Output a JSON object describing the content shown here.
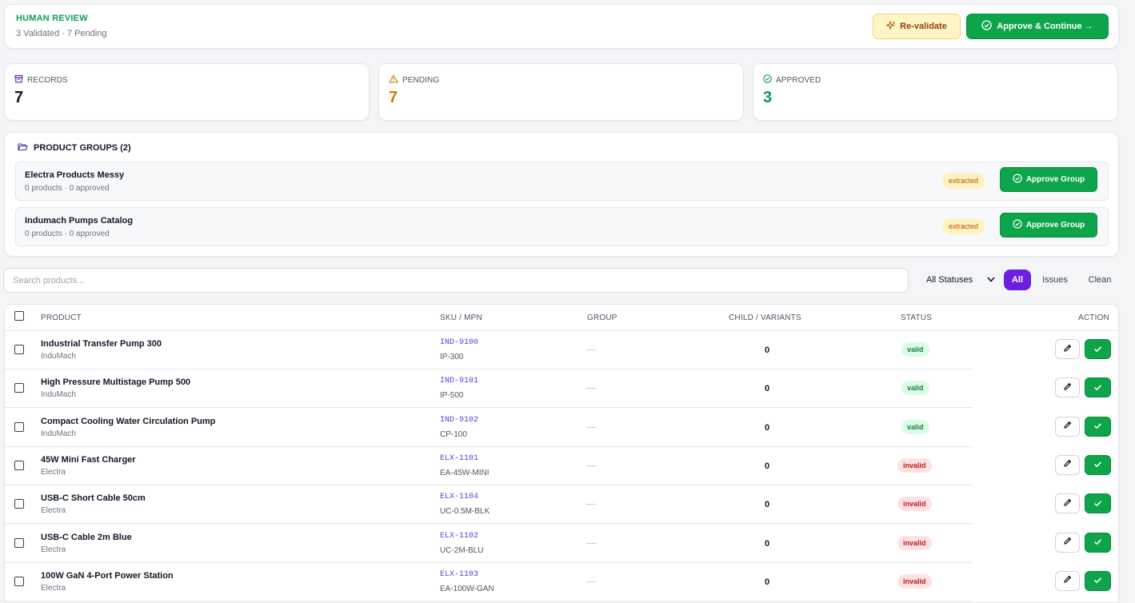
{
  "header": {
    "title": "HUMAN REVIEW",
    "subtitle": "3 Validated · 7 Pending",
    "revalidate_label": "Re-validate",
    "approve_continue_label": "Approve & Continue →"
  },
  "stats": {
    "records": {
      "label": "RECORDS",
      "value": "7",
      "color": "#111827"
    },
    "pending": {
      "label": "PENDING",
      "value": "7",
      "color": "#d97706"
    },
    "approved": {
      "label": "APPROVED",
      "value": "3",
      "color": "#059669"
    }
  },
  "groups": {
    "title": "PRODUCT GROUPS (2)",
    "items": [
      {
        "name": "Electra Products Messy",
        "sub": "0 products · 0 approved",
        "badge": "extracted",
        "button": "Approve Group"
      },
      {
        "name": "Indumach Pumps Catalog",
        "sub": "0 products · 0 approved",
        "badge": "extracted",
        "button": "Approve Group"
      }
    ]
  },
  "filters": {
    "search_placeholder": "Search products...",
    "status_select": "All Statuses",
    "all": "All",
    "issues": "Issues",
    "clean": "Clean"
  },
  "table": {
    "columns": {
      "product": "PRODUCT",
      "sku": "SKU / MPN",
      "group": "GROUP",
      "child": "CHILD / VARIANTS",
      "status": "STATUS",
      "action": "ACTION"
    },
    "rows": [
      {
        "name": "Industrial Transfer Pump 300",
        "brand": "InduMach",
        "sku": "IND-9100",
        "mpn": "IP-300",
        "child": "0",
        "status": "valid"
      },
      {
        "name": "High Pressure Multistage Pump 500",
        "brand": "InduMach",
        "sku": "IND-9101",
        "mpn": "IP-500",
        "child": "0",
        "status": "valid"
      },
      {
        "name": "Compact Cooling Water Circulation Pump",
        "brand": "InduMach",
        "sku": "IND-9102",
        "mpn": "CP-100",
        "child": "0",
        "status": "valid"
      },
      {
        "name": "45W Mini Fast Charger",
        "brand": "Electra",
        "sku": "ELX-1101",
        "mpn": "EA-45W-MINI",
        "child": "0",
        "status": "invalid"
      },
      {
        "name": "USB-C Short Cable 50cm",
        "brand": "Electra",
        "sku": "ELX-1104",
        "mpn": "UC-0.5M-BLK",
        "child": "0",
        "status": "invalid"
      },
      {
        "name": "USB-C Cable 2m Blue",
        "brand": "Electra",
        "sku": "ELX-1102",
        "mpn": "UC-2M-BLU",
        "child": "0",
        "status": "invalid"
      },
      {
        "name": "100W GaN 4-Port Power Station",
        "brand": "Electra",
        "sku": "ELX-1103",
        "mpn": "EA-100W-GAN",
        "child": "0",
        "status": "invalid"
      }
    ]
  }
}
